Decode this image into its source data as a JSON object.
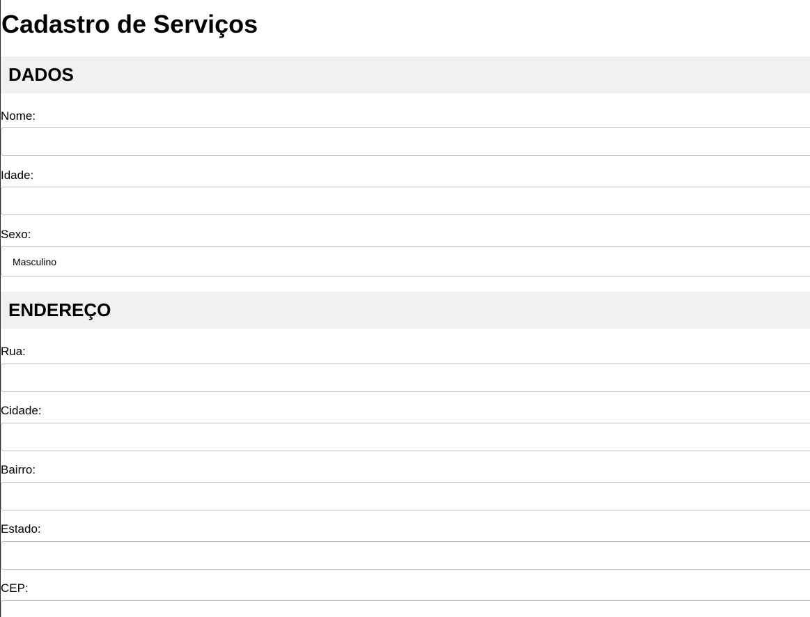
{
  "page": {
    "title": "Cadastro de Serviços"
  },
  "sections": {
    "dados": {
      "heading": "DADOS",
      "fields": {
        "nome": {
          "label": "Nome:",
          "value": ""
        },
        "idade": {
          "label": "Idade:",
          "value": ""
        },
        "sexo": {
          "label": "Sexo:",
          "selected": "Masculino"
        }
      }
    },
    "endereco": {
      "heading": "ENDEREÇO",
      "fields": {
        "rua": {
          "label": "Rua:",
          "value": ""
        },
        "cidade": {
          "label": "Cidade:",
          "value": ""
        },
        "bairro": {
          "label": "Bairro:",
          "value": ""
        },
        "estado": {
          "label": "Estado:",
          "value": ""
        },
        "cep": {
          "label": "CEP:",
          "value": ""
        }
      }
    }
  },
  "colors": {
    "section_header_bg": "#f1f1f1",
    "input_border": "#bdbdbd",
    "text": "#000000"
  }
}
